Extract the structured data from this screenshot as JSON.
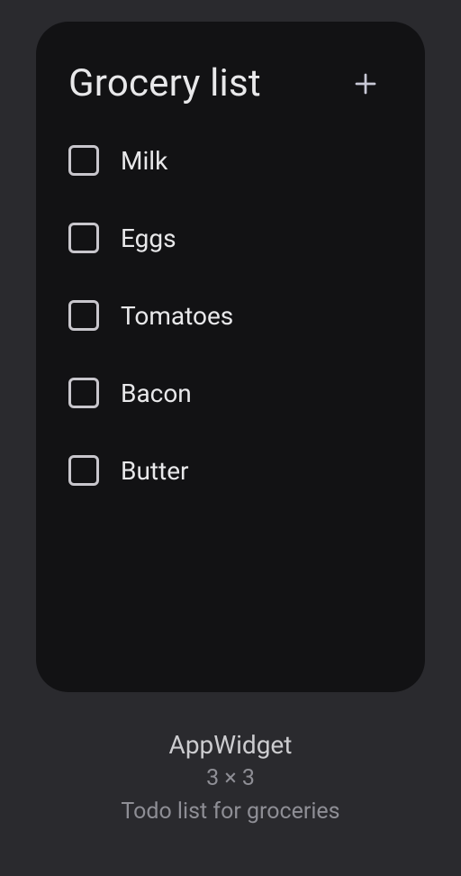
{
  "widget": {
    "title": "Grocery list",
    "items": [
      {
        "label": "Milk"
      },
      {
        "label": "Eggs"
      },
      {
        "label": "Tomatoes"
      },
      {
        "label": "Bacon"
      },
      {
        "label": "Butter"
      }
    ]
  },
  "info": {
    "name": "AppWidget",
    "size": "3 × 3",
    "description": "Todo list for groceries"
  }
}
